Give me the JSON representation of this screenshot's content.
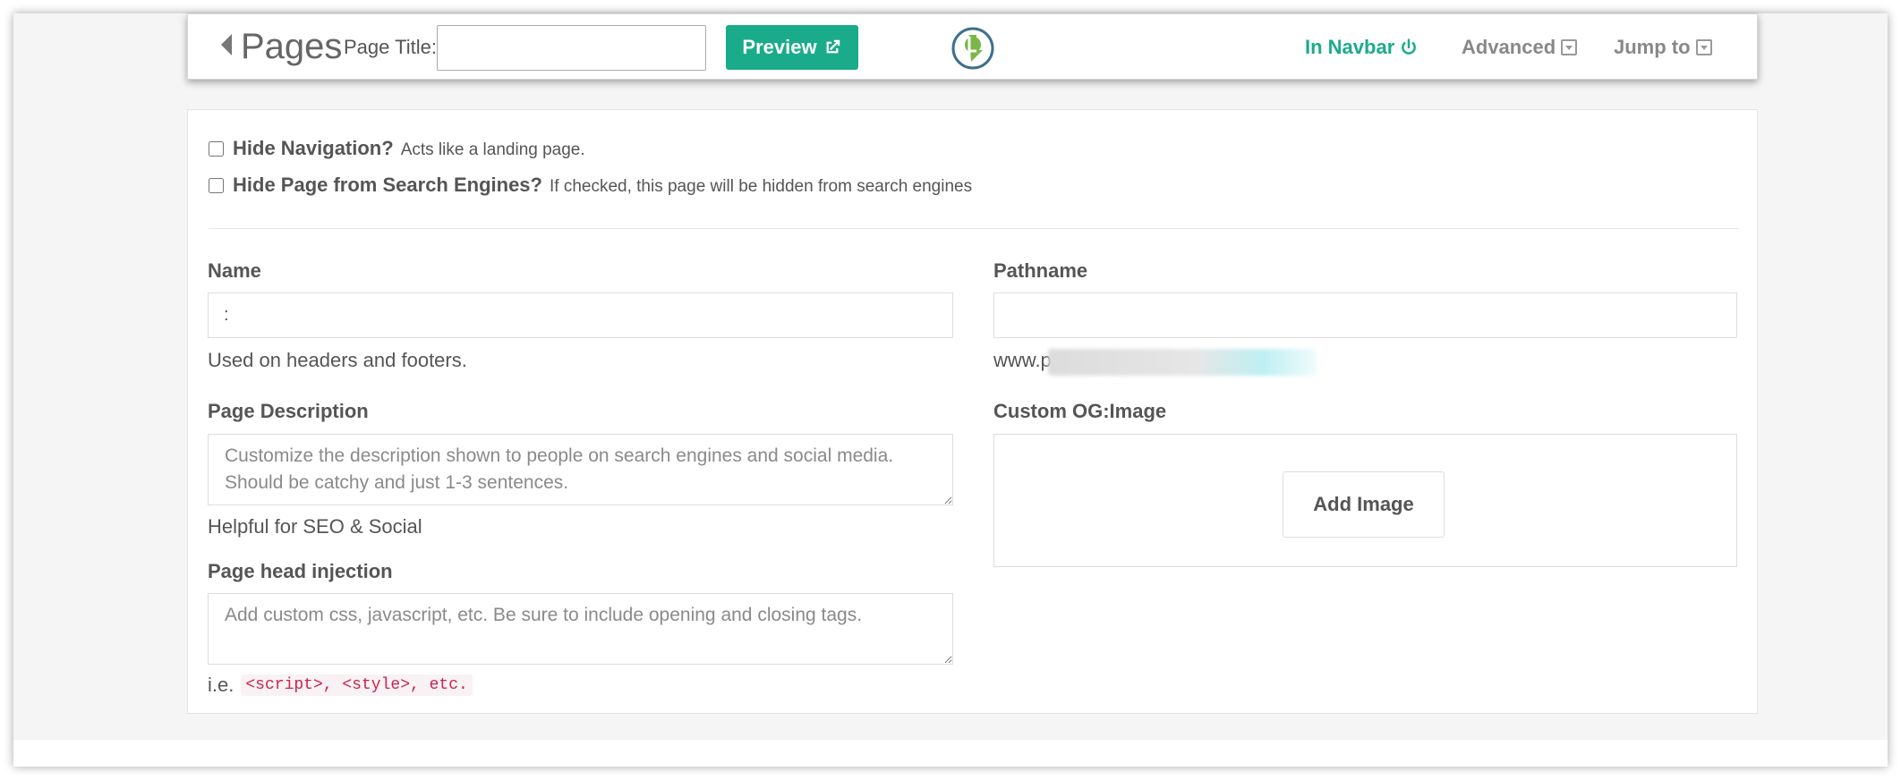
{
  "header": {
    "back_label": "Pages",
    "page_title_label": "Page Title:",
    "page_title_value": "",
    "preview_label": "Preview",
    "nav_navbar": "In Navbar",
    "nav_advanced": "Advanced",
    "nav_jump": "Jump to"
  },
  "options": {
    "hide_nav_label": "Hide Navigation?",
    "hide_nav_help": "Acts like a landing page.",
    "hide_search_label": "Hide Page from Search Engines?",
    "hide_search_help": "If checked, this page will be hidden from search engines"
  },
  "form": {
    "name_label": "Name",
    "name_value": ":",
    "name_help": "Used on headers and footers.",
    "description_label": "Page Description",
    "description_placeholder": "Customize the description shown to people on search engines and social media. Should be catchy and just 1-3 sentences.",
    "description_help": "Helpful for SEO & Social",
    "head_label": "Page head injection",
    "head_placeholder": "Add custom css, javascript, etc. Be sure to include opening and closing tags.",
    "head_help_prefix": "i.e.",
    "head_help_code": "<script>, <style>, etc.",
    "pathname_label": "Pathname",
    "pathname_value": "",
    "pathname_help": "www.p",
    "og_label": "Custom OG:Image",
    "add_image_label": "Add Image"
  },
  "colors": {
    "accent": "#1aab8a",
    "code_red": "#c7254e"
  }
}
